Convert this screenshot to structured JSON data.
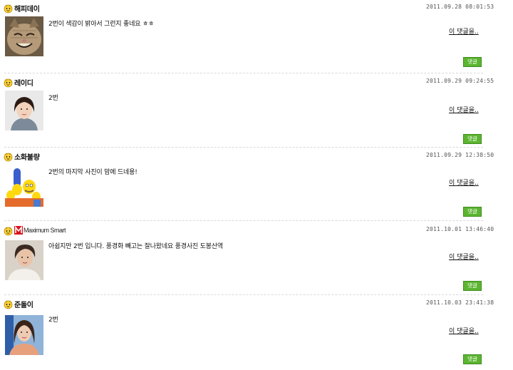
{
  "comments": [
    {
      "nickname": "해피데이",
      "date": "2011.09.28  08:01:53",
      "text": "2번이 색감이 밝아서 그런지 좋네요 ㅎㅎ",
      "reply_link": "이 댓글을..",
      "reply_button": "댓글",
      "avatar_icon": "smiling-cat-photo"
    },
    {
      "nickname": "레이디",
      "date": "2011.09.29  09:24:55",
      "text": "2번",
      "reply_link": "이 댓글을..",
      "reply_button": "댓글",
      "avatar_icon": "woman-portrait-photo"
    },
    {
      "nickname": "소화불량",
      "date": "2011.09.29  12:38:50",
      "text": "2번의 마지막 사진이 맘에 드네용!",
      "reply_link": "이 댓글을..",
      "reply_button": "댓글",
      "avatar_icon": "cartoon-family-image"
    },
    {
      "nickname": "Maximum Smart",
      "date": "2011.10.01  13:46:40",
      "text": "아쉽지만 2번 입니다. 풍경화 빼고는 잘나왔네요 풍경사진 도봉산역",
      "reply_link": "이 댓글을..",
      "reply_button": "댓글",
      "avatar_icon": "person-photo",
      "nickname_logo": "maximum-smart-logo"
    },
    {
      "nickname": "준돌이",
      "date": "2011.10.03  23:41:38",
      "text": "2번",
      "reply_link": "이 댓글을..",
      "reply_button": "댓글",
      "avatar_icon": "woman-photo"
    }
  ],
  "colors": {
    "reply_button_bg": "#5cb531",
    "divider": "#d9d9d9"
  }
}
